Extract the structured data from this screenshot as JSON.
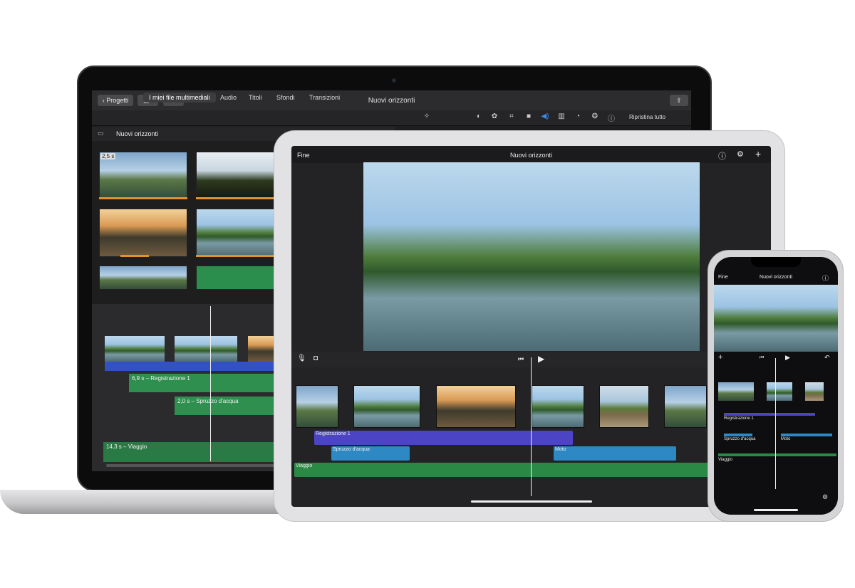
{
  "mac": {
    "back_button": "Progetti",
    "title": "Nuovi orizzonti",
    "tabs": [
      "I miei file multimediali",
      "Audio",
      "Titoli",
      "Sfondi",
      "Transizioni"
    ],
    "reset_all": "Ripristina tutto",
    "library_title": "Nuovi orizzonti",
    "thumb_duration": "2,5 s",
    "clips": {
      "registrazione": "6,9 s – Registrazione 1",
      "spruzzo": "2,0 s – Spruzzo d'acqua",
      "viaggio": "14,3 s – Viaggio"
    }
  },
  "ipad": {
    "done": "Fine",
    "title": "Nuovi orizzonti",
    "tracks": {
      "registrazione": "Registrazione 1",
      "spruzzo": "Spruzzo d'acqua",
      "moto": "Moto",
      "viaggio": "Viaggio"
    }
  },
  "iphone": {
    "done": "Fine",
    "title": "Nuovi orizzonti",
    "tracks": {
      "registrazione": "Registrazione 1",
      "spruzzo": "Spruzzo d'acqua",
      "moto": "Moto",
      "viaggio": "Viaggio"
    }
  },
  "colors": {
    "accent_green": "#2f8f4e",
    "accent_blue": "#3a55c9",
    "accent_cyan": "#3aa6d8",
    "orange": "#e2912b"
  }
}
